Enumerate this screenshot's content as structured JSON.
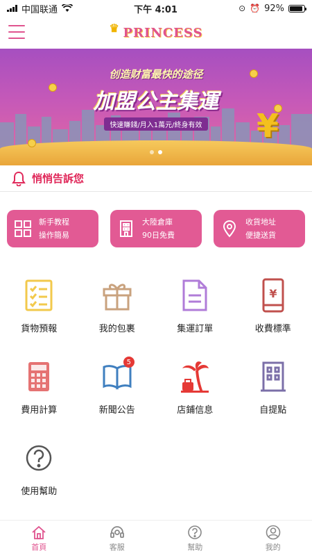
{
  "status_bar": {
    "carrier": "中国联通",
    "time": "下午 4:01",
    "battery": "92%",
    "battery_level": 0.92
  },
  "header": {
    "logo_text": "PRINCESS"
  },
  "banner": {
    "line1": "创造财富最快的途径",
    "line2": "加盟公主集運",
    "line3": "快速賺錢/月入1萬元/終身有效",
    "slide_count": 2,
    "active_slide": 2
  },
  "notice": {
    "text": "悄悄告訴您"
  },
  "quick_cards": [
    {
      "icon": "grid-squares-icon",
      "line1": "新手教程",
      "line2": "操作簡易"
    },
    {
      "icon": "building-icon",
      "line1": "大陸倉庫",
      "line2": "90日免費"
    },
    {
      "icon": "location-pin-icon",
      "line1": "收貨地址",
      "line2": "便捷送貨"
    }
  ],
  "grid": [
    {
      "icon": "checklist-icon",
      "label": "貨物預報",
      "color": "#f2c94c"
    },
    {
      "icon": "gift-icon",
      "label": "我的包裹",
      "color": "#c9a27e"
    },
    {
      "icon": "document-icon",
      "label": "集運訂單",
      "color": "#b07cd8"
    },
    {
      "icon": "phone-yen-icon",
      "label": "收費標準",
      "color": "#c0504d"
    },
    {
      "icon": "calculator-icon",
      "label": "費用計算",
      "color": "#e57373"
    },
    {
      "icon": "open-book-icon",
      "label": "新聞公告",
      "color": "#3f7fbf",
      "badge": "5"
    },
    {
      "icon": "palm-tree-shop-icon",
      "label": "店鋪信息",
      "color": "#e53935"
    },
    {
      "icon": "office-building-icon",
      "label": "自提點",
      "color": "#7b6fa8"
    },
    {
      "icon": "help-circle-icon",
      "label": "使用幫助",
      "color": "#555555"
    }
  ],
  "tabbar": [
    {
      "icon": "home-icon",
      "label": "首頁",
      "active": true
    },
    {
      "icon": "headset-icon",
      "label": "客服",
      "active": false
    },
    {
      "icon": "question-icon",
      "label": "幫助",
      "active": false
    },
    {
      "icon": "user-icon",
      "label": "我的",
      "active": false
    }
  ],
  "colors": {
    "accent": "#e0548f",
    "notice": "#e0285a"
  }
}
